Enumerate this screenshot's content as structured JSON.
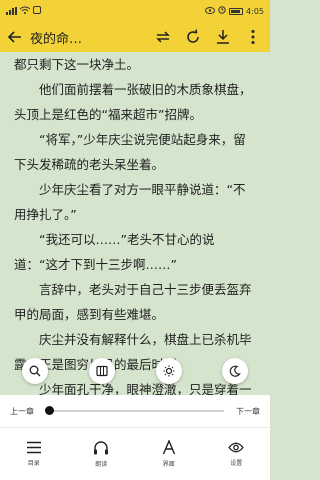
{
  "status_bar": {
    "left_icons": "signal wifi notification",
    "time": "4:05"
  },
  "toolbar": {
    "title": "夜的命…"
  },
  "reader": {
    "paragraphs": [
      "都只剩下这一块净土。",
      "他们面前摆着一张破旧的木质象棋盘，头顶上是红色的“福来超市”招牌。",
      "“将军，”少年庆尘说完便站起身来，留下头发稀疏的老头呆坐着。",
      "少年庆尘看了对方一眼平静说道：“不用挣扎了。”",
      "“我还可以……”老头不甘心的说道：“这才下到十三步啊……”",
      "言辞中，老头对于自己十三步便丢盔弃甲的局面，感到有些难堪。",
      "庆尘并没有解释什么，棋盘上已杀机毕露，正是图穷匕见的最后时刻。",
      "少年面孔干净，眼神澄澈，只是穿着一身校服，站在那里，像是被净化的世界都给净化的透明了一般。"
    ]
  },
  "fab": [
    "search",
    "toggle-panel",
    "brightness",
    "night-mode"
  ],
  "chapter_bar": {
    "prev_label": "上一章",
    "next_label": "下一章",
    "progress": 0.02
  },
  "bottom_nav": {
    "items": [
      {
        "label": "目录"
      },
      {
        "label": "朗读"
      },
      {
        "label": "界面"
      },
      {
        "label": "设置"
      }
    ]
  },
  "colors": {
    "accent": "#f2d237",
    "reader_bg": "#d5e4cc",
    "text": "#222222"
  }
}
